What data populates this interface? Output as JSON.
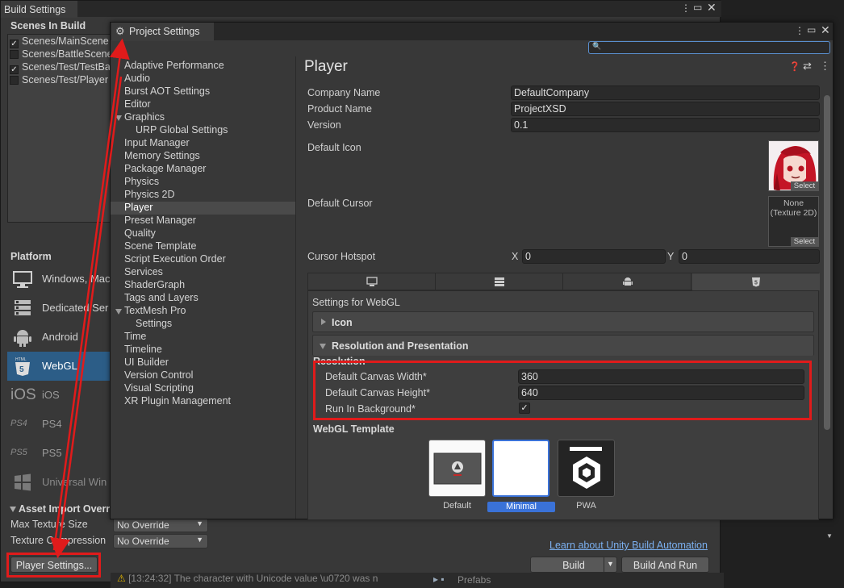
{
  "build": {
    "window_title": "Build Settings",
    "scenes_title": "Scenes In Build",
    "scenes": [
      {
        "name": "Scenes/MainScene",
        "checked": true
      },
      {
        "name": "Scenes/BattleScene",
        "checked": false
      },
      {
        "name": "Scenes/Test/TestBa",
        "checked": true
      },
      {
        "name": "Scenes/Test/Player",
        "checked": false
      }
    ],
    "platform_title": "Platform",
    "platforms": [
      {
        "name": "Windows, Mac",
        "icon": "monitor-icon"
      },
      {
        "name": "Dedicated Ser",
        "icon": "server-icon"
      },
      {
        "name": "Android",
        "icon": "android-icon"
      },
      {
        "name": "WebGL",
        "icon": "html5-icon"
      },
      {
        "name": "iOS",
        "icon": "ios-icon"
      },
      {
        "name": "PS4",
        "icon": "ps4-icon"
      },
      {
        "name": "PS5",
        "icon": "ps5-icon"
      },
      {
        "name": "Universal Win",
        "icon": "windows-icon"
      }
    ],
    "asset_title": "Asset Import Overri",
    "max_texture_label": "Max Texture Size",
    "max_texture_value": "No Override",
    "texture_compression_label": "Texture Compression",
    "texture_compression_value": "No Override",
    "player_settings_btn": "Player Settings...",
    "learn_link": "Learn about Unity Build Automation",
    "build_btn": "Build",
    "build_and_run_btn": "Build And Run",
    "console_text": "[13:24:32] The character with Unicode value \\u0720 was n",
    "project_folder": "Prefabs"
  },
  "project_settings": {
    "tab_title": "Project Settings",
    "nav": [
      {
        "label": "Adaptive Performance"
      },
      {
        "label": "Audio"
      },
      {
        "label": "Burst AOT Settings"
      },
      {
        "label": "Editor"
      },
      {
        "label": "Graphics",
        "expanded": true
      },
      {
        "label": "URP Global Settings",
        "child": true
      },
      {
        "label": "Input Manager"
      },
      {
        "label": "Memory Settings"
      },
      {
        "label": "Package Manager"
      },
      {
        "label": "Physics"
      },
      {
        "label": "Physics 2D"
      },
      {
        "label": "Player",
        "selected": true
      },
      {
        "label": "Preset Manager"
      },
      {
        "label": "Quality"
      },
      {
        "label": "Scene Template"
      },
      {
        "label": "Script Execution Order"
      },
      {
        "label": "Services"
      },
      {
        "label": "ShaderGraph"
      },
      {
        "label": "Tags and Layers"
      },
      {
        "label": "TextMesh Pro",
        "expanded": true
      },
      {
        "label": "Settings",
        "child": true
      },
      {
        "label": "Time"
      },
      {
        "label": "Timeline"
      },
      {
        "label": "UI Builder"
      },
      {
        "label": "Version Control"
      },
      {
        "label": "Visual Scripting"
      },
      {
        "label": "XR Plugin Management"
      }
    ],
    "player": {
      "title": "Player",
      "company_label": "Company Name",
      "company_value": "DefaultCompany",
      "product_label": "Product Name",
      "product_value": "ProjectXSD",
      "version_label": "Version",
      "version_value": "0.1",
      "default_icon_label": "Default Icon",
      "default_cursor_label": "Default Cursor",
      "cursor_none": "None",
      "cursor_type": "(Texture 2D)",
      "select_label": "Select",
      "hotspot_label": "Cursor Hotspot",
      "hotspot_x_label": "X",
      "hotspot_x": "0",
      "hotspot_y_label": "Y",
      "hotspot_y": "0",
      "settings_for": "Settings for WebGL",
      "icon_fold": "Icon",
      "resolution_fold": "Resolution and Presentation",
      "resolution_header": "Resolution",
      "canvas_width_label": "Default Canvas Width*",
      "canvas_width": "360",
      "canvas_height_label": "Default Canvas Height*",
      "canvas_height": "640",
      "run_bg_label": "Run In Background*",
      "run_bg_checked": true,
      "webgl_template_title": "WebGL Template",
      "templates": [
        {
          "name": "Default",
          "selected": false
        },
        {
          "name": "Minimal",
          "selected": true
        },
        {
          "name": "PWA",
          "selected": false
        }
      ]
    }
  },
  "colors": {
    "highlight_red": "#e01b1b",
    "selection_blue": "#2c5d87",
    "link_blue": "#7bb0f0"
  }
}
